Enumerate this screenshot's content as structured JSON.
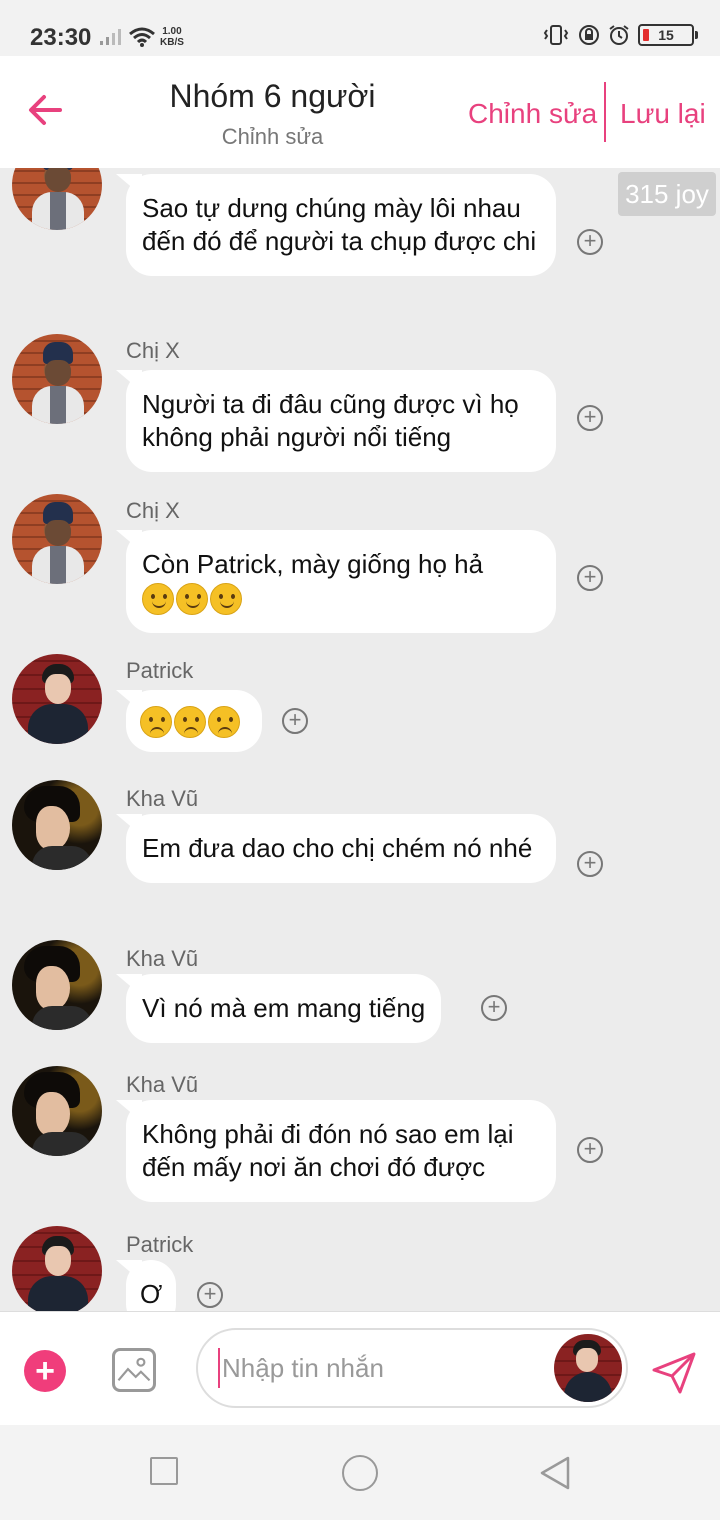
{
  "status": {
    "time": "23:30",
    "speed_value": "1.00",
    "speed_unit": "KB/S",
    "battery": "15"
  },
  "header": {
    "title": "Nhóm 6 người",
    "subtitle": "Chỉnh sửa",
    "edit_label": "Chỉnh sửa",
    "save_label": "Lưu lại"
  },
  "joy_badge": "315 joy",
  "messages": [
    {
      "sender": "",
      "text": "Sao tự dưng chúng mày lôi nhau đến đó để người ta chụp được chi"
    },
    {
      "sender": "Chị X",
      "text": "Người ta đi đâu cũng được vì họ không phải người nổi tiếng"
    },
    {
      "sender": "Chị X",
      "text": "Còn Patrick, mày giống họ hả",
      "emoji": "slightly-smiling-face x3"
    },
    {
      "sender": "Patrick",
      "emoji": "worried-face x3"
    },
    {
      "sender": "Kha Vũ",
      "text": "Em đưa dao cho chị chém nó nhé"
    },
    {
      "sender": "Kha Vũ",
      "text": "Vì nó mà em mang tiếng"
    },
    {
      "sender": "Kha Vũ",
      "text": "Không phải đi đón nó sao em lại đến mấy nơi ăn chơi đó được"
    },
    {
      "sender": "Patrick",
      "text": "Ơ"
    }
  ],
  "input": {
    "placeholder": "Nhập tin nhắn"
  },
  "colors": {
    "accent": "#e8417e",
    "add_button": "#f03d7b",
    "chat_background": "#ececec",
    "bubble": "#ffffff"
  }
}
